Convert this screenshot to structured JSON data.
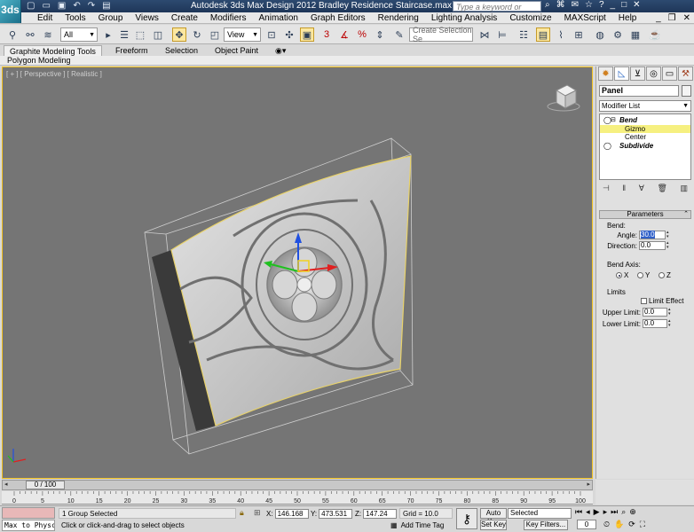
{
  "app": {
    "logo": "3ds",
    "title": "Autodesk 3ds Max Design 2012    Bradley Residence Staircase.max",
    "search_placeholder": "Type a keyword or phrase"
  },
  "menu": [
    "Edit",
    "Tools",
    "Group",
    "Views",
    "Create",
    "Modifiers",
    "Animation",
    "Graph Editors",
    "Rendering",
    "Lighting Analysis",
    "Customize",
    "MAXScript",
    "Help"
  ],
  "toolbar": {
    "filter_value": "All",
    "refcoord_value": "View",
    "selection_set_placeholder": "Create Selection Se",
    "snap_label": "3"
  },
  "ribbon": {
    "tabs": [
      "Graphite Modeling Tools",
      "Freeform",
      "Selection",
      "Object Paint"
    ],
    "subtab": "Polygon Modeling"
  },
  "viewport": {
    "label": "[ + ] [ Perspective ] [ Realistic ]"
  },
  "command_panel": {
    "object_name": "Panel",
    "modifier_list": "Modifier List",
    "stack": [
      {
        "label": "Bend",
        "level": "modifier"
      },
      {
        "label": "Gizmo",
        "level": "sub",
        "selected": true
      },
      {
        "label": "Center",
        "level": "sub"
      },
      {
        "label": "Subdivide",
        "level": "modifier"
      }
    ],
    "parameters": {
      "title": "Parameters",
      "bend_label": "Bend:",
      "angle_label": "Angle:",
      "angle_value": "30.0",
      "direction_label": "Direction:",
      "direction_value": "0.0",
      "bend_axis_label": "Bend Axis:",
      "axis_x": "X",
      "axis_y": "Y",
      "axis_z": "Z",
      "limits_label": "Limits",
      "limit_effect": "Limit Effect",
      "upper_limit_label": "Upper Limit:",
      "upper_limit_value": "0.0",
      "lower_limit_label": "Lower Limit:",
      "lower_limit_value": "0.0"
    }
  },
  "timeline": {
    "slider_value": "0 / 100",
    "ticks": [
      0,
      5,
      10,
      15,
      20,
      25,
      30,
      35,
      40,
      45,
      50,
      55,
      60,
      65,
      70,
      75,
      80,
      85,
      90,
      95,
      100
    ]
  },
  "status": {
    "script_input": "Max to Physc",
    "selection_msg": "1 Group Selected",
    "prompt": "Click or click-and-drag to select objects",
    "x_label": "X:",
    "x_value": "146.168",
    "y_label": "Y:",
    "y_value": "473.531",
    "z_label": "Z:",
    "z_value": "147.24",
    "grid": "Grid = 10.0",
    "add_time_tag": "Add Time Tag",
    "auto_key": "Auto Key",
    "set_key": "Set Key",
    "selected": "Selected",
    "key_filters": "Key Filters...",
    "frame_value": "0"
  }
}
